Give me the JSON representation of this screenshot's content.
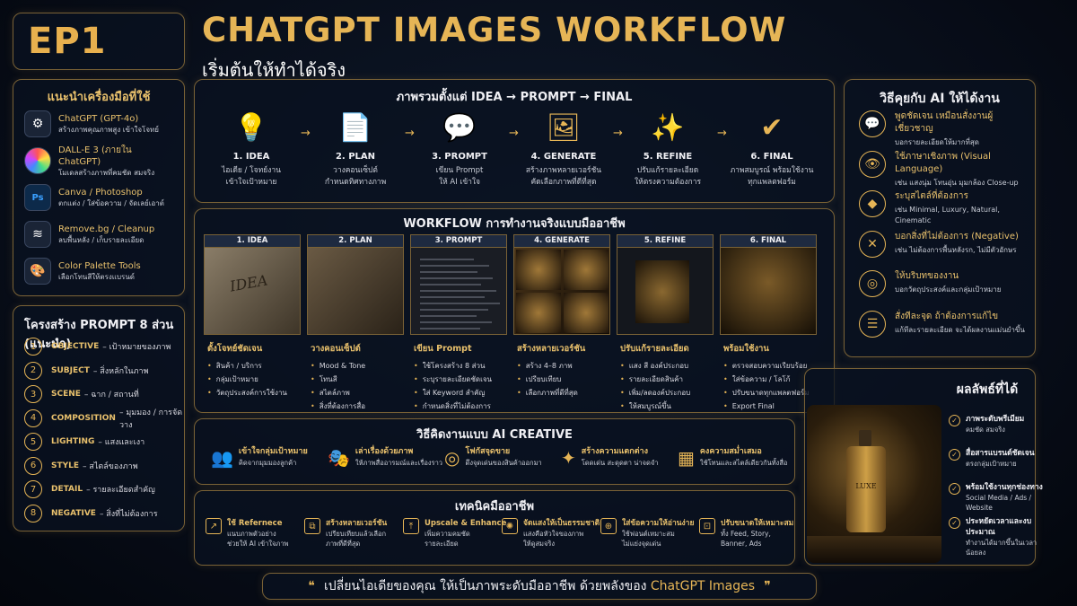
{
  "episode": "EP1",
  "title": "CHATGPT IMAGES WORKFLOW",
  "subtitle": "เริ่มต้นให้ทำได้จริง",
  "tools": {
    "title": "แนะนำเครื่องมือที่ใช้",
    "items": [
      {
        "name": "ChatGPT (GPT-4o)",
        "desc": "สร้างภาพคุณภาพสูง เข้าใจโจทย์"
      },
      {
        "name": "DALL-E 3 (ภายใน ChatGPT)",
        "desc": "โมเดลสร้างภาพที่คมชัด สมจริง"
      },
      {
        "name": "Canva / Photoshop",
        "desc": "ตกแต่ง / ใส่ข้อความ / จัดเลย์เอาต์"
      },
      {
        "name": "Remove.bg / Cleanup",
        "desc": "ลบพื้นหลัง / เก็บรายละเอียด"
      },
      {
        "name": "Color Palette Tools",
        "desc": "เลือกโทนสีให้ตรงแบรนด์"
      }
    ]
  },
  "prompt_structure": {
    "title": "โครงสร้าง PROMPT 8 ส่วน (แนะนำ)",
    "items": [
      {
        "n": "1",
        "key": "OBJECTIVE",
        "desc": "– เป้าหมายของภาพ"
      },
      {
        "n": "2",
        "key": "SUBJECT",
        "desc": "– สิ่งหลักในภาพ"
      },
      {
        "n": "3",
        "key": "SCENE",
        "desc": "– ฉาก / สถานที่"
      },
      {
        "n": "4",
        "key": "COMPOSITION",
        "desc": "– มุมมอง / การจัดวาง"
      },
      {
        "n": "5",
        "key": "LIGHTING",
        "desc": "– แสงและเงา"
      },
      {
        "n": "6",
        "key": "STYLE",
        "desc": "– สไตล์ของภาพ"
      },
      {
        "n": "7",
        "key": "DETAIL",
        "desc": "– รายละเอียดสำคัญ"
      },
      {
        "n": "8",
        "key": "NEGATIVE",
        "desc": "– สิ่งที่ไม่ต้องการ"
      }
    ]
  },
  "overview": {
    "title": "ภาพรวมตั้งแต่ IDEA → PROMPT → FINAL",
    "arrow": "→",
    "steps": [
      {
        "title": "1. IDEA",
        "desc1": "ไอเดีย / โจทย์งาน",
        "desc2": "เข้าใจเป้าหมาย",
        "icon": "lightbulb-icon",
        "glyph": "💡"
      },
      {
        "title": "2. PLAN",
        "desc1": "วางคอนเซ็ปต์",
        "desc2": "กำหนดทิศทางภาพ",
        "icon": "document-icon",
        "glyph": "📄"
      },
      {
        "title": "3. PROMPT",
        "desc1": "เขียน Prompt",
        "desc2": "ให้ AI เข้าใจ",
        "icon": "chat-icon",
        "glyph": "💬"
      },
      {
        "title": "4. GENERATE",
        "desc1": "สร้างภาพหลายเวอร์ชัน",
        "desc2": "คัดเลือกภาพที่ดีที่สุด",
        "icon": "image-icon",
        "glyph": "🖼"
      },
      {
        "title": "5. REFINE",
        "desc1": "ปรับแก้รายละเอียด",
        "desc2": "ให้ตรงความต้องการ",
        "icon": "magic-wand-icon",
        "glyph": "✨"
      },
      {
        "title": "6. FINAL",
        "desc1": "ภาพสมบูรณ์ พร้อมใช้งาน",
        "desc2": "ทุกแพลตฟอร์ม",
        "icon": "check-circle-icon",
        "glyph": "✔"
      }
    ]
  },
  "workflow": {
    "title": "WORKFLOW การทำงานจริงแบบมืออาชีพ",
    "cards": [
      {
        "label": "1. IDEA",
        "title": "ตั้งโจทย์ชัดเจน",
        "bullets": [
          "สินค้า / บริการ",
          "กลุ่มเป้าหมาย",
          "วัตถุประสงค์การใช้งาน"
        ],
        "img_text": "IDEA"
      },
      {
        "label": "2. PLAN",
        "title": "วางคอนเซ็ปต์",
        "bullets": [
          "Mood & Tone",
          "โทนสี",
          "สไตล์ภาพ",
          "สิ่งที่ต้องการสื่อ"
        ]
      },
      {
        "label": "3. PROMPT",
        "title": "เขียน Prompt",
        "bullets": [
          "ใช้โครงสร้าง 8 ส่วน",
          "ระบุรายละเอียดชัดเจน",
          "ใส่ Keyword สำคัญ",
          "กำหนดสิ่งที่ไม่ต้องการ"
        ]
      },
      {
        "label": "4. GENERATE",
        "title": "สร้างหลายเวอร์ชัน",
        "bullets": [
          "สร้าง 4–8 ภาพ",
          "เปรียบเทียบ",
          "เลือกภาพที่ดีที่สุด"
        ]
      },
      {
        "label": "5. REFINE",
        "title": "ปรับแก้รายละเอียด",
        "bullets": [
          "แสง สี องค์ประกอบ",
          "รายละเอียดสินค้า",
          "เพิ่ม/ลดองค์ประกอบ",
          "ให้สมบูรณ์ขึ้น"
        ]
      },
      {
        "label": "6. FINAL",
        "title": "พร้อมใช้งาน",
        "bullets": [
          "ตรวจสอบความเรียบร้อย",
          "ใส่ข้อความ / โลโก้",
          "ปรับขนาดทุกแพลตฟอร์ม",
          "Export Final"
        ]
      }
    ]
  },
  "ai_creative": {
    "title": "วิธีคิดงานแบบ AI CREATIVE",
    "items": [
      {
        "t": "เข้าใจกลุ่มเป้าหมาย",
        "d": "คิดจากมุมมองลูกค้า",
        "glyph": "👥",
        "icon": "audience-icon"
      },
      {
        "t": "เล่าเรื่องด้วยภาพ",
        "d": "ให้ภาพสื่ออารมณ์และเรื่องราว",
        "glyph": "🎭",
        "icon": "storytelling-icon"
      },
      {
        "t": "โฟกัสจุดขาย",
        "d": "ดึงจุดเด่นของสินค้าออกมา",
        "glyph": "◎",
        "icon": "focus-icon"
      },
      {
        "t": "สร้างความแตกต่าง",
        "d": "โดดเด่น สะดุดตา น่าจดจำ",
        "glyph": "✦",
        "icon": "differentiate-icon"
      },
      {
        "t": "คงความสม่ำเสมอ",
        "d": "ใช้โทนและสไตล์เดียวกันทั้งสื่อ",
        "glyph": "▦",
        "icon": "consistency-icon"
      }
    ]
  },
  "techniques": {
    "title": "เทคนิคมืออาชีพ",
    "items": [
      {
        "t": "ใช้ Refernece",
        "d1": "แนบภาพตัวอย่าง",
        "d2": "ช่วยให้ AI เข้าใจภาพ"
      },
      {
        "t": "สร้างหลายเวอร์ชัน",
        "d1": "เปรียบเทียบแล้วเลือก",
        "d2": "ภาพที่ดีที่สุด"
      },
      {
        "t": "Upscale & Enhance",
        "d1": "เพิ่มความคมชัด",
        "d2": "รายละเอียด"
      },
      {
        "t": "จัดแสงให้เป็นธรรมชาติ",
        "d1": "แสงคือหัวใจของภาพ",
        "d2": "ให้ดูสมจริง"
      },
      {
        "t": "ใส่ข้อความให้อ่านง่าย",
        "d1": "ใช้ฟอนต์เหมาะสม",
        "d2": "ไม่แย่งจุดเด่น"
      },
      {
        "t": "ปรับขนาดให้เหมาะสม",
        "d1": "ทั้ง Feed, Story,",
        "d2": "Banner, Ads"
      }
    ]
  },
  "tips": {
    "title": "วิธีคุยกับ AI ให้ได้งาน",
    "items": [
      {
        "t": "พูดชัดเจน เหมือนสั่งงานผู้เชี่ยวชาญ",
        "d": "บอกรายละเอียดให้มากที่สุด",
        "glyph": "💬",
        "icon": "speech-icon"
      },
      {
        "t": "ใช้ภาษาเชิงภาพ (Visual Language)",
        "d": "เช่น แสงนุ่ม โทนอุ่น มุมกล้อง Close-up",
        "glyph": "👁",
        "icon": "eye-icon"
      },
      {
        "t": "ระบุสไตล์ที่ต้องการ",
        "d": "เช่น Minimal, Luxury, Natural, Cinematic",
        "glyph": "◆",
        "icon": "diamond-icon"
      },
      {
        "t": "บอกสิ่งที่ไม่ต้องการ (Negative)",
        "d": "เช่น ไม่ต้องการพื้นหลังรก, ไม่มีตัวอักษร",
        "glyph": "✕",
        "icon": "negative-icon"
      },
      {
        "t": "ให้บริบทของงาน",
        "d": "บอกวัตถุประสงค์และกลุ่มเป้าหมาย",
        "glyph": "◎",
        "icon": "target-icon"
      },
      {
        "t": "สั่งทีละจุด ถ้าต้องการแก้ไข",
        "d": "แก้ทีละรายละเอียด จะได้ผลงานแม่นยำขึ้น",
        "glyph": "☰",
        "icon": "sliders-icon"
      }
    ]
  },
  "results": {
    "title": "ผลลัพธ์ที่ได้",
    "bottle_label": "LUXE",
    "items": [
      {
        "t": "ภาพระดับพรีเมียม",
        "d": "คมชัด สมจริง"
      },
      {
        "t": "สื่อสารแบรนด์ชัดเจน",
        "d": "ตรงกลุ่มเป้าหมาย"
      },
      {
        "t": "พร้อมใช้งานทุกช่องทาง",
        "d": "Social Media / Ads / Website"
      },
      {
        "t": "ประหยัดเวลาและงบประมาณ",
        "d": "ทำงานได้มากขึ้นในเวลาน้อยลง"
      }
    ]
  },
  "quote": {
    "open": "❝",
    "text": "เปลี่ยนไอเดียของคุณ ให้เป็นภาพระดับมืออาชีพ ด้วยพลังของ",
    "brand": "ChatGPT Images",
    "close": "❞"
  },
  "colors": {
    "gold": "#e6b556",
    "background": "#070c17",
    "border": "#7a6236"
  }
}
